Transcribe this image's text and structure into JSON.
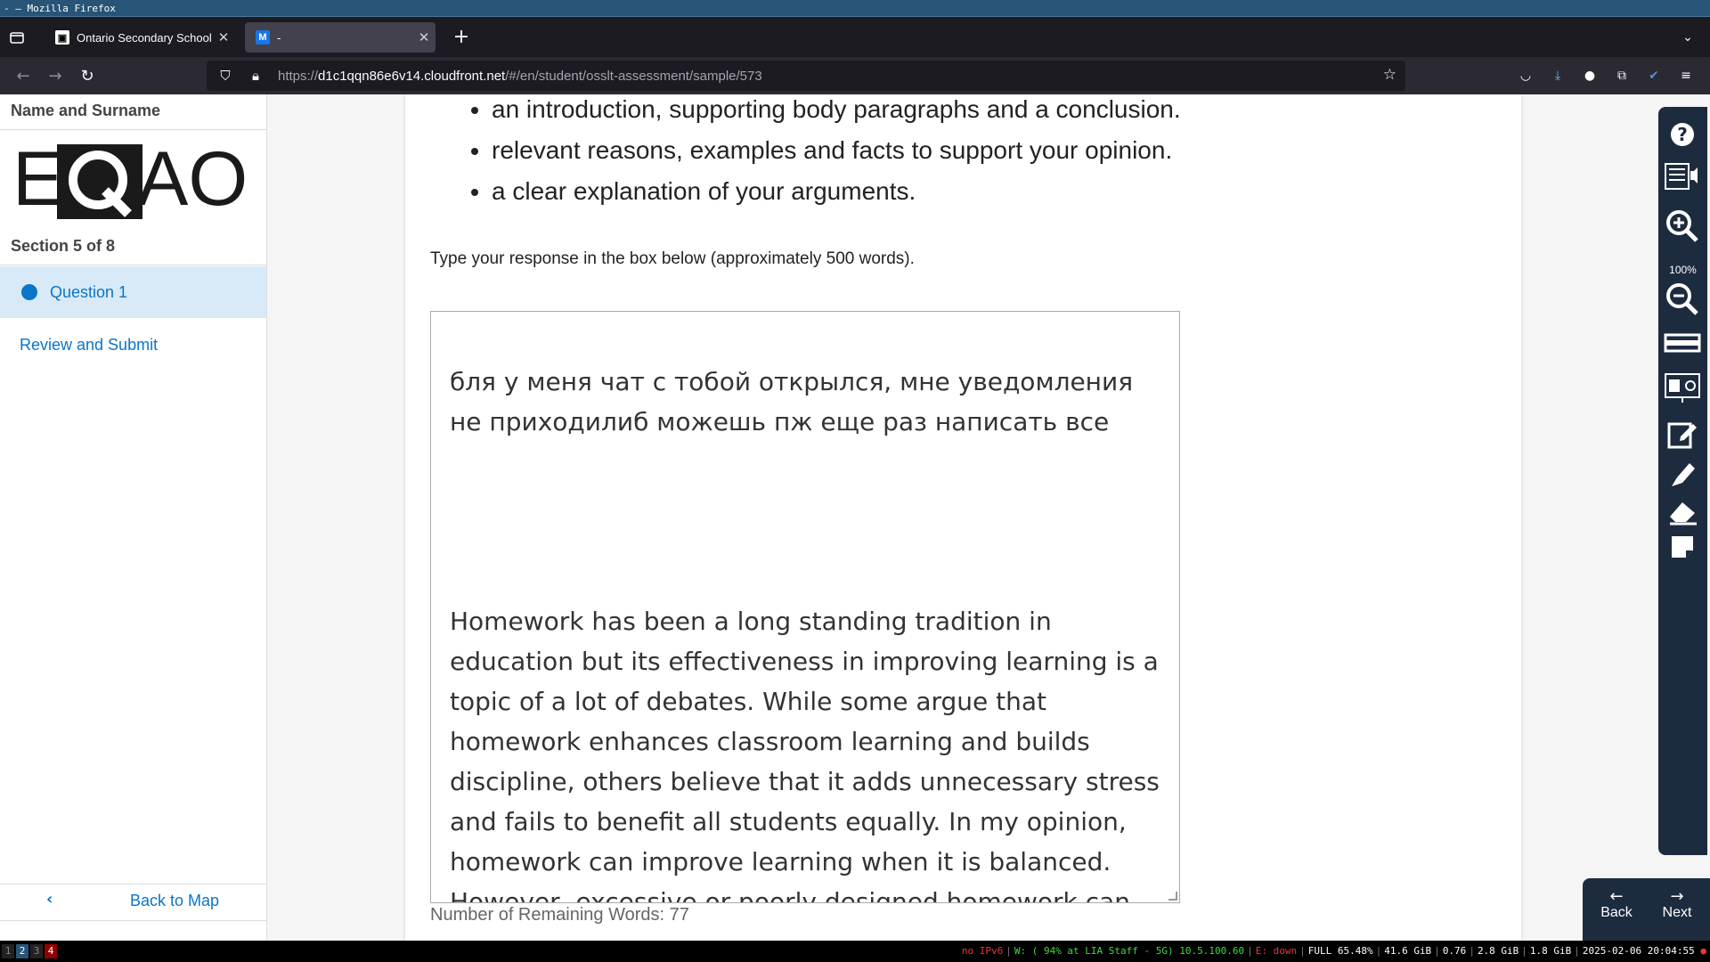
{
  "window": {
    "title": "- — Mozilla Firefox"
  },
  "tabs": [
    {
      "label": "Ontario Secondary School Literacy Test",
      "favicon": "eqao-favicon"
    },
    {
      "label": "-",
      "favicon": "M"
    }
  ],
  "url": {
    "host": "d1c1qqn86e6v14.cloudfront.net",
    "prefix": "https://",
    "path": "/#/en/student/osslt-assessment/sample/573"
  },
  "sidebar": {
    "student_name": "Name and Surname",
    "logo_text": "EQAO",
    "section": "Section 5 of 8",
    "question": "Question 1",
    "review": "Review and Submit",
    "back_to_map": "Back to Map"
  },
  "content": {
    "bullets": [
      "an introduction, supporting body paragraphs and a conclusion.",
      "relevant reasons, examples and facts to support your opinion.",
      "a clear explanation of your arguments."
    ],
    "instruction": "Type your response in the box below (approximately 500 words).",
    "response_p1": "бля у меня чат с тобой открылся, мне уведомления не приходилиб можешь пж еще раз написать все",
    "response_p2": "Homework has been a long standing tradition in education but its effectiveness in improving learning is a topic of a lot of debates. While some argue that homework enhances classroom learning and builds discipline, others believe that it adds unnecessary stress and fails to benefit all students equally. In my opinion, homework can improve learning when it is balanced. However, excessive or poorly designed homework can have the opposite effect on students.",
    "word_count": "Number of Remaining Words: 77"
  },
  "toolbar": {
    "zoom": "100%"
  },
  "nav": {
    "back": "Back",
    "next": "Next"
  },
  "statusbar": {
    "workspaces": [
      "1",
      "2",
      "3",
      "4"
    ],
    "ipv6": "no IPv6",
    "wifi": "W: ( 94% at LIA Staff - 5G) 10.5.100.60",
    "eth": "E: down",
    "disk": "FULL 65.48%",
    "mem_free": "41.6 GiB",
    "load": "0.76",
    "mem_used": "2.8 GiB",
    "swap": "1.8 GiB",
    "datetime": "2025-02-06 20:04:55"
  }
}
